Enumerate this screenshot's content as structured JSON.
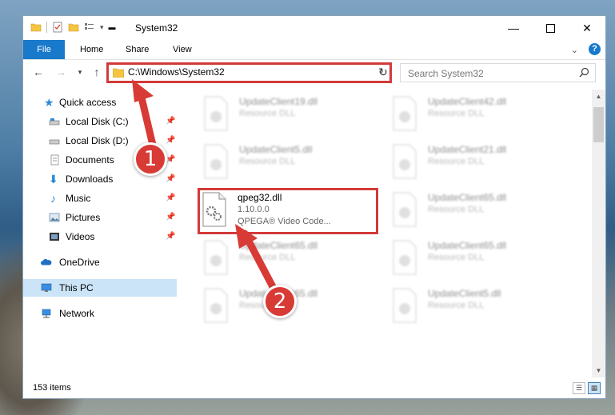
{
  "window": {
    "title": "System32"
  },
  "ribbon": {
    "file": "File",
    "home": "Home",
    "share": "Share",
    "view": "View",
    "expand_icon": "chevron-down-icon",
    "help_icon": "?"
  },
  "nav": {
    "address_path": "C:\\Windows\\System32",
    "search_placeholder": "Search System32"
  },
  "sidebar": {
    "items": [
      {
        "label": "Quick access",
        "icon": "star-icon"
      },
      {
        "label": "Local Disk (C:)",
        "icon": "drive-icon"
      },
      {
        "label": "Local Disk (D:)",
        "icon": "drive-icon"
      },
      {
        "label": "Documents",
        "icon": "documents-icon"
      },
      {
        "label": "Downloads",
        "icon": "download-icon"
      },
      {
        "label": "Music",
        "icon": "music-icon"
      },
      {
        "label": "Pictures",
        "icon": "pictures-icon"
      },
      {
        "label": "Videos",
        "icon": "videos-icon"
      },
      {
        "label": "OneDrive",
        "icon": "cloud-icon"
      },
      {
        "label": "This PC",
        "icon": "computer-icon"
      },
      {
        "label": "Network",
        "icon": "network-icon"
      }
    ]
  },
  "files": [
    {
      "name": "UpdateClient19.dll",
      "type": "Resource DLL"
    },
    {
      "name": "UpdateClient42.dll",
      "type": "Resource DLL"
    },
    {
      "name": "UpdateClient5.dll",
      "type": "Resource DLL"
    },
    {
      "name": "UpdateClient21.dll",
      "type": "Resource DLL"
    },
    {
      "name": "qpeg32.dll",
      "version": "1.10.0.0",
      "type": "QPEGA® Video Code..."
    },
    {
      "name": "UpdateClient65.dll",
      "type": "Resource DLL"
    },
    {
      "name": "UpdateClient65.dll",
      "type": "Resource DLL"
    },
    {
      "name": "UpdateClient65.dll",
      "type": "Resource DLL"
    },
    {
      "name": "UpdateClient65.dll",
      "type": "Resource DLL"
    },
    {
      "name": "UpdateClient5.dll",
      "type": "Resource DLL"
    }
  ],
  "status": {
    "count": "153 items"
  },
  "annotations": {
    "step1": "1",
    "step2": "2",
    "color": "#d33a3a"
  }
}
